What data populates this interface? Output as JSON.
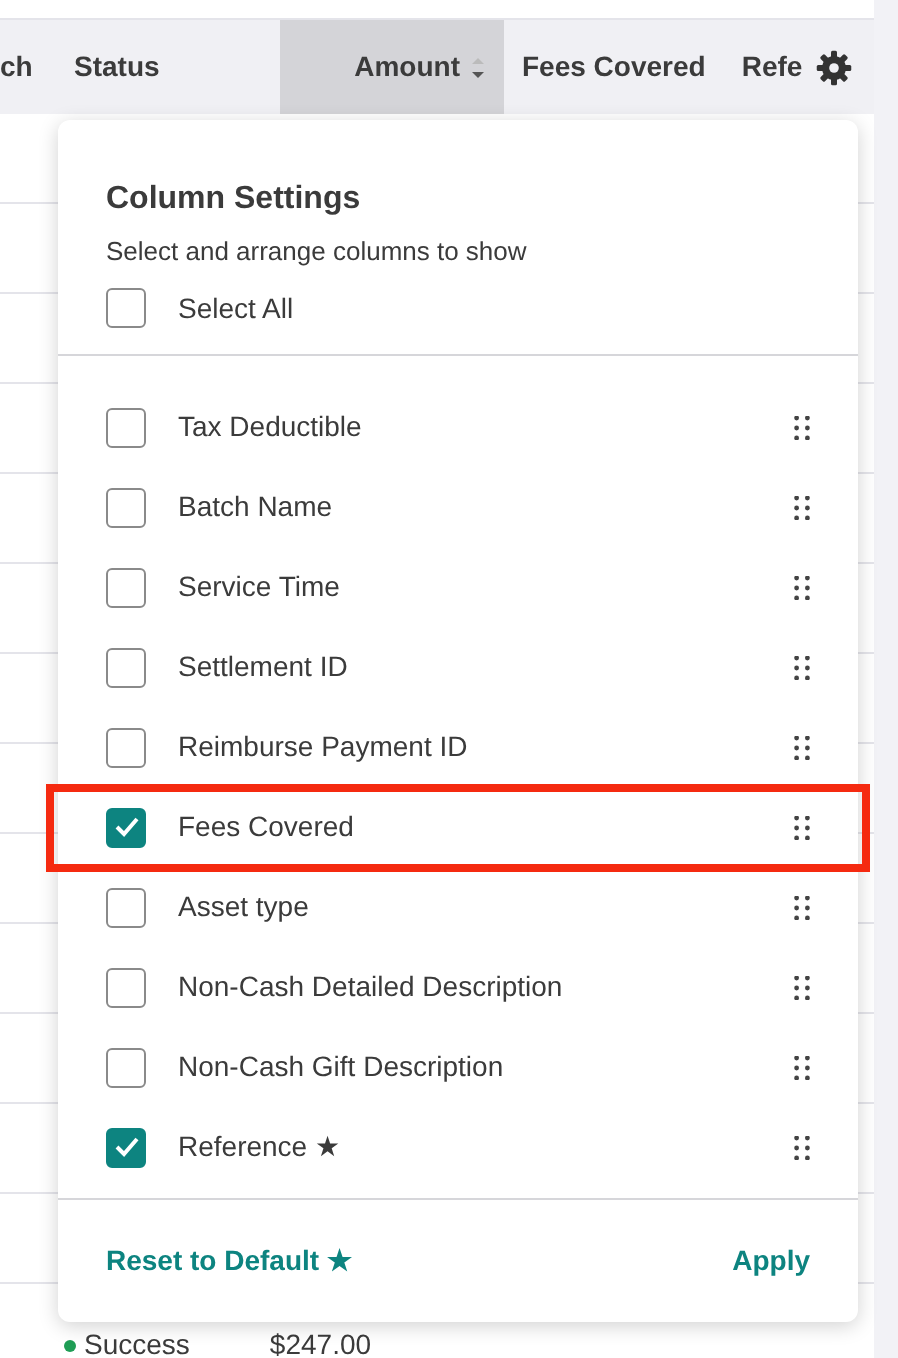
{
  "table": {
    "columns": [
      {
        "label": "ch",
        "sorted": false
      },
      {
        "label": "Status",
        "sorted": false
      },
      {
        "label": "Amount",
        "sorted": true
      },
      {
        "label": "Fees Covered",
        "sorted": false
      },
      {
        "label": "Refe",
        "sorted": false
      }
    ],
    "rows": [
      {
        "status": "Success",
        "amount": "$247.00"
      }
    ]
  },
  "column_settings": {
    "title": "Column Settings",
    "subtitle": "Select and arrange columns to show",
    "select_all": {
      "label": "Select All",
      "checked": false
    },
    "items": [
      {
        "label": "Tax Deductible",
        "checked": false,
        "highlighted": false
      },
      {
        "label": "Batch Name",
        "checked": false,
        "highlighted": false
      },
      {
        "label": "Service Time",
        "checked": false,
        "highlighted": false
      },
      {
        "label": "Settlement ID",
        "checked": false,
        "highlighted": false
      },
      {
        "label": "Reimburse Payment ID",
        "checked": false,
        "highlighted": false
      },
      {
        "label": "Fees Covered",
        "checked": true,
        "highlighted": true
      },
      {
        "label": "Asset type",
        "checked": false,
        "highlighted": false
      },
      {
        "label": "Non-Cash Detailed Description",
        "checked": false,
        "highlighted": false
      },
      {
        "label": "Non-Cash Gift Description",
        "checked": false,
        "highlighted": false
      },
      {
        "label": "Reference ★",
        "checked": true,
        "highlighted": false
      }
    ],
    "reset": "Reset to Default ★",
    "apply": "Apply"
  }
}
